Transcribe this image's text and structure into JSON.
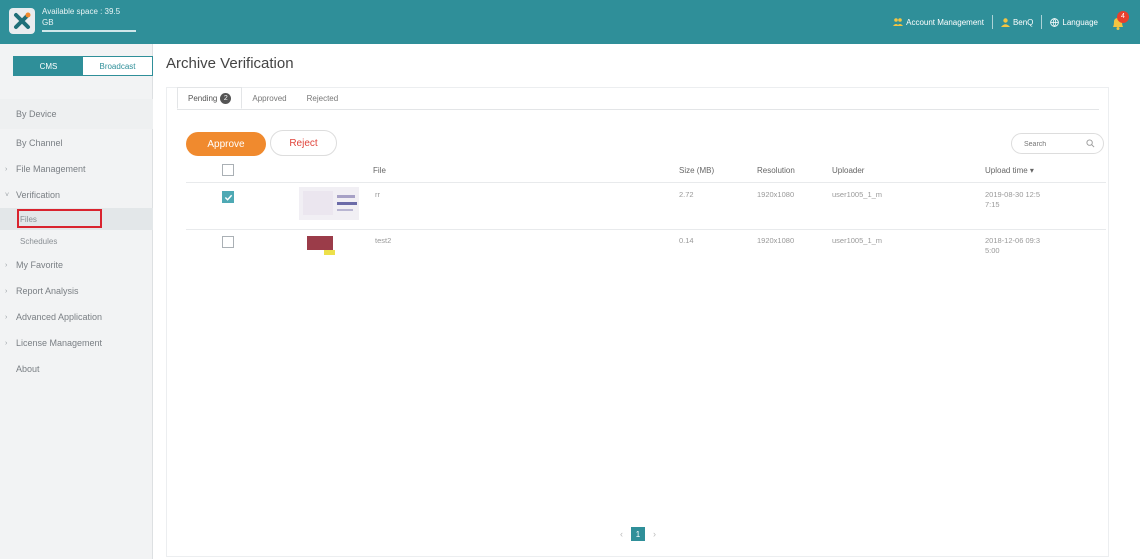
{
  "header": {
    "available_space_label": "Available space : 39.5",
    "available_space_unit": "GB",
    "account_management": "Account Management",
    "user": "BenQ",
    "language": "Language",
    "notification_count": "4"
  },
  "sidebar": {
    "modes": [
      "CMS",
      "Broadcast"
    ],
    "items": [
      {
        "label": "By Device"
      },
      {
        "label": "By Channel"
      },
      {
        "label": "File Management"
      },
      {
        "label": "Verification"
      },
      {
        "label": "Files"
      },
      {
        "label": "Schedules"
      },
      {
        "label": "My Favorite"
      },
      {
        "label": "Report Analysis"
      },
      {
        "label": "Advanced Application"
      },
      {
        "label": "License Management"
      },
      {
        "label": "About"
      }
    ]
  },
  "main": {
    "title": "Archive Verification",
    "tabs": [
      {
        "label": "Pending",
        "badge": "2"
      },
      {
        "label": "Approved"
      },
      {
        "label": "Rejected"
      }
    ],
    "approve_label": "Approve",
    "reject_label": "Reject",
    "search_placeholder": "Search",
    "columns": [
      "File",
      "Size (MB)",
      "Resolution",
      "Uploader",
      "Upload time"
    ],
    "sort_indicator": "▾",
    "rows": [
      {
        "file": "rr",
        "size": "2.72",
        "resolution": "1920x1080",
        "uploader": "user1005_1_m",
        "time_line1": "2019-08-30 12:5",
        "time_line2": "7:15",
        "checked": true
      },
      {
        "file": "test2",
        "size": "0.14",
        "resolution": "1920x1080",
        "uploader": "user1005_1_m",
        "time_line1": "2018-12-06 09:3",
        "time_line2": "5:00",
        "checked": false
      }
    ],
    "pagination": {
      "prev": "‹",
      "current": "1",
      "next": "›"
    }
  },
  "colors": {
    "brand": "#2f8f99",
    "approve": "#f08a2e",
    "reject_text": "#e0443b",
    "highlight_box": "#d9232e"
  }
}
